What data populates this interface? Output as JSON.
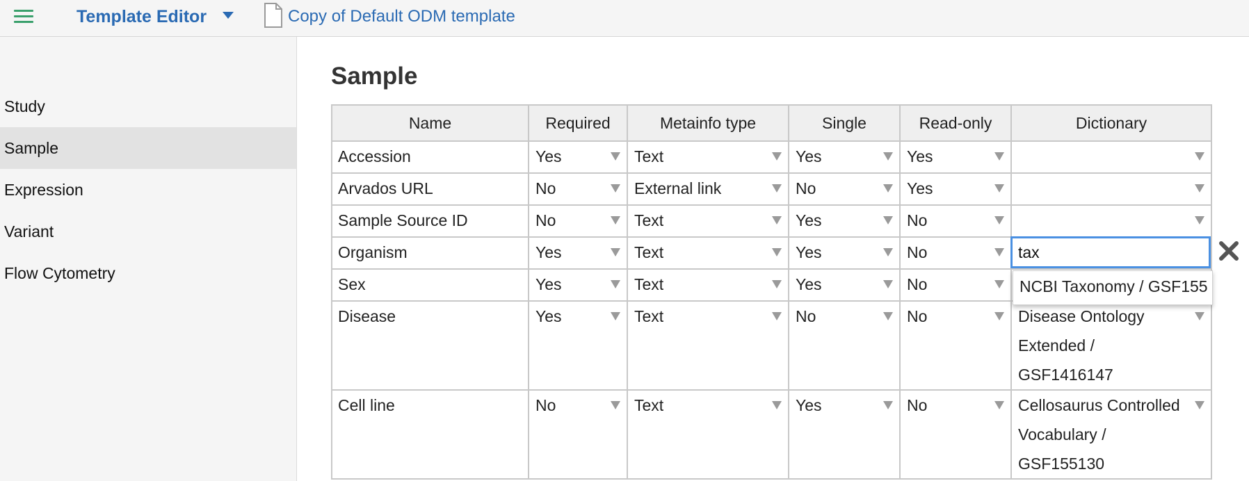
{
  "header": {
    "menu_icon": "hamburger-menu-icon",
    "app_title": "Template Editor",
    "doc_title": "Copy of Default ODM template",
    "accent": "#2a6ab3",
    "menu_color": "#3aa06c"
  },
  "sidebar": {
    "items": [
      {
        "label": "Study"
      },
      {
        "label": "Sample"
      },
      {
        "label": "Expression"
      },
      {
        "label": "Variant"
      },
      {
        "label": "Flow Cytometry"
      }
    ],
    "active": "Sample"
  },
  "main": {
    "title": "Sample",
    "columns": [
      "Name",
      "Required",
      "Metainfo type",
      "Single",
      "Read-only",
      "Dictionary"
    ],
    "rows": [
      {
        "name": "Accession",
        "required": "Yes",
        "type": "Text",
        "single": "Yes",
        "readonly": "Yes",
        "dict_lines": []
      },
      {
        "name": "Arvados URL",
        "required": "No",
        "type": "External link",
        "single": "No",
        "readonly": "Yes",
        "dict_lines": []
      },
      {
        "name": "Sample Source ID",
        "required": "No",
        "type": "Text",
        "single": "Yes",
        "readonly": "No",
        "dict_lines": []
      },
      {
        "name": "Organism",
        "required": "Yes",
        "type": "Text",
        "single": "Yes",
        "readonly": "No",
        "dict_input": "tax"
      },
      {
        "name": "Sex",
        "required": "Yes",
        "type": "Text",
        "single": "Yes",
        "readonly": "No",
        "dict_lines": []
      },
      {
        "name": "Disease",
        "required": "Yes",
        "type": "Text",
        "single": "No",
        "readonly": "No",
        "dict_lines": [
          "Disease Ontology",
          "Extended /",
          "GSF1416147"
        ]
      },
      {
        "name": "Cell line",
        "required": "No",
        "type": "Text",
        "single": "Yes",
        "readonly": "No",
        "dict_lines": [
          "Cellosaurus Controlled",
          "Vocabulary /",
          "GSF155130"
        ]
      }
    ],
    "suggestion": "NCBI Taxonomy / GSF155",
    "input_focus_color": "#4a90e2"
  }
}
